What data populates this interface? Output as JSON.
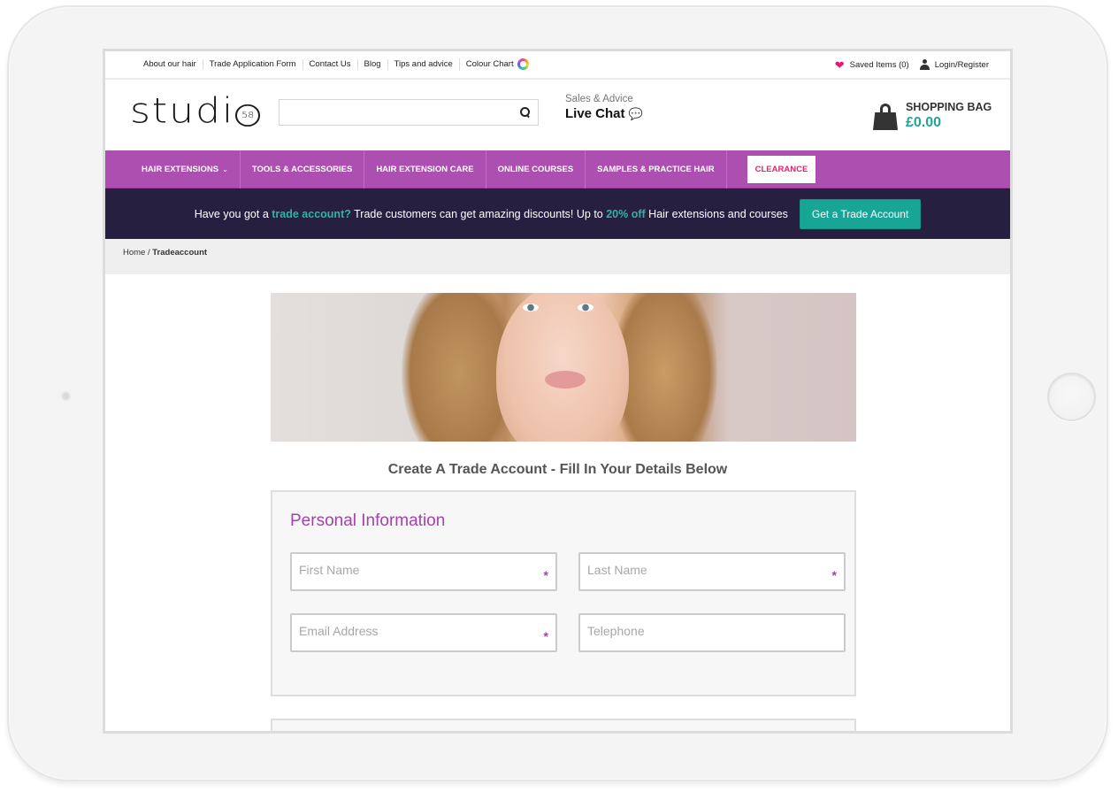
{
  "top_bar": {
    "links": [
      "About our hair",
      "Trade Application Form",
      "Contact Us",
      "Blog",
      "Tips and advice",
      "Colour Chart"
    ],
    "saved_items": "Saved Items (0)",
    "login": "Login/Register"
  },
  "header": {
    "logo_text": "studi",
    "logo_badge": "58",
    "search_value": "",
    "search_placeholder": "",
    "sales_label": "Sales & Advice",
    "live_chat": "Live Chat",
    "bag_label": "SHOPPING BAG",
    "bag_total": "£0.00"
  },
  "nav": {
    "items": [
      "HAIR EXTENSIONS",
      "TOOLS & ACCESSORIES",
      "HAIR EXTENSION CARE",
      "ONLINE COURSES",
      "SAMPLES & PRACTICE HAIR"
    ],
    "clearance": "CLEARANCE"
  },
  "promo": {
    "text1": "Have you got a",
    "hl1": "trade account?",
    "text2": "Trade customers can get amazing discounts! Up to",
    "hl2": "20% off",
    "text3": "Hair extensions and courses",
    "button": "Get a Trade Account"
  },
  "breadcrumb": {
    "home": "Home",
    "separator": "/",
    "current": "Tradeaccount"
  },
  "form": {
    "title": "Create A Trade Account - Fill In Your Details Below",
    "section_title": "Personal Information",
    "fields": [
      {
        "placeholder": "First Name",
        "value": "",
        "required": true
      },
      {
        "placeholder": "Last Name",
        "value": "",
        "required": true
      },
      {
        "placeholder": "Email Address",
        "value": "",
        "required": true
      },
      {
        "placeholder": "Telephone",
        "value": "",
        "required": false
      }
    ],
    "required_marker": "*"
  },
  "colors": {
    "brand_purple": "#ad4fb0",
    "promo_bg": "#261f3f",
    "accent_teal": "#17a596",
    "clearance_pink": "#e0256e",
    "heart_pink": "#e4177a"
  }
}
